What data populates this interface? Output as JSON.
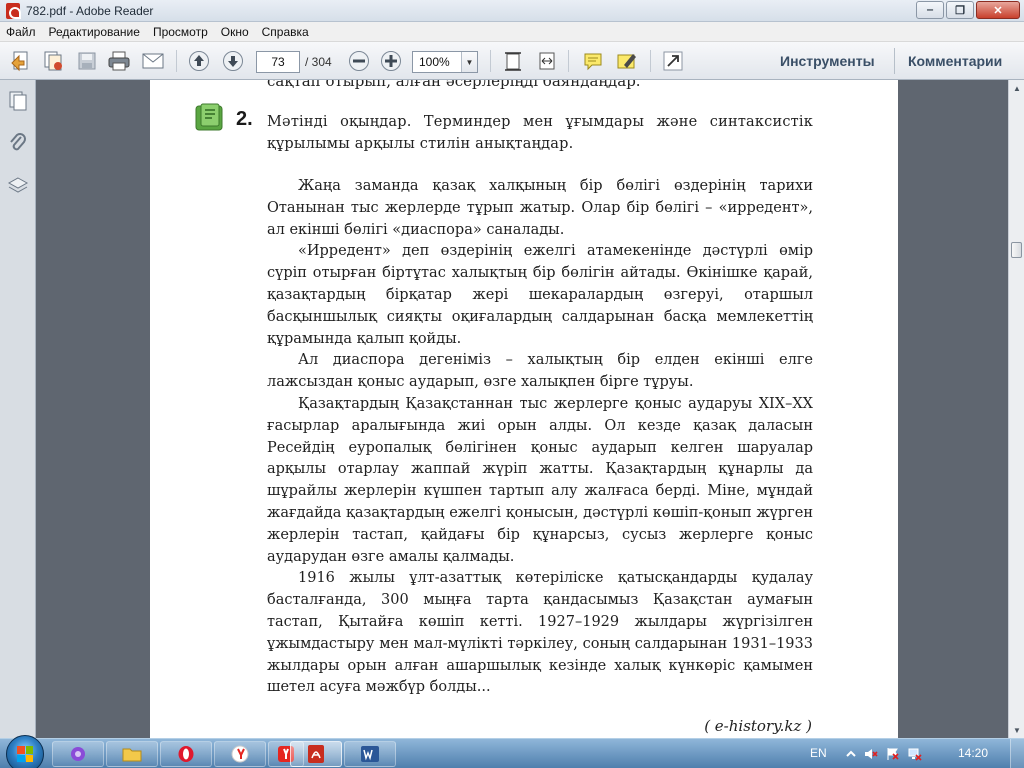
{
  "window": {
    "title": "782.pdf - Adobe Reader",
    "minimize_label": "‒",
    "restore_label": "❐",
    "close_label": "✕"
  },
  "menu": [
    "Файл",
    "Редактирование",
    "Просмотр",
    "Окно",
    "Справка"
  ],
  "toolbar": {
    "current_page": "73",
    "total_pages": "/ 304",
    "zoom": "100%",
    "zoom_dropdown_glyph": "▼",
    "tools_label": "Инструменты",
    "comments_label": "Комментарии"
  },
  "document": {
    "cut_line": "сақтап отырып, алған әсерлеріңді баяндаңдар.",
    "task_number": "2.",
    "task_text": "Мәтінді оқыңдар. Терминдер мен ұғымдары және синтаксистік құрылымы арқылы стилін анықтаңдар.",
    "paragraphs": [
      "Жаңа заманда қазақ халқының бір бөлігі өздерінің тарихи Отанынан тыс жерлерде тұрып жатыр. Олар бір бөлігі – «ирредент», ал екінші бөлігі «диаспора» саналады.",
      "«Ирредент» деп өздерінің ежелгі атамекенінде дәстүрлі өмір сүріп отырған біртұтас халықтың бір бөлігін айтады. Өкінішке қарай, қазақтардың бірқатар жері шекаралардың өзгеруі, отаршыл басқыншылық сияқты оқиғалардың салдарынан басқа мемлекеттің құрамында қалып қойды.",
      "Ал диаспора дегеніміз – халықтың бір елден екінші елге лажсыздан қоныс аударып, өзге халықпен бірге тұруы.",
      "Қазақтардың Қазақстаннан тыс жерлерге қоныс аударуы XIX–XX ғасырлар аралығында жиі орын алды. Ол кезде қазақ даласын Ресейдің еуропалық бөлігінен қоныс аударып келген шаруалар арқылы отарлау жаппай жүріп жатты. Қазақтардың құнарлы да шұрайлы жерлерін күшпен тартып алу жалғаса берді. Міне, мұндай жағдайда қазақтардың ежелгі қонысын, дәстүрлі көшіп-қонып жүрген жерлерін тастап, қайдағы бір құнарсыз, сусыз жерлерге қоныс аударудан өзге амалы қалмады.",
      "1916 жылы ұлт-азаттық көтеріліске қатысқандарды қудалау басталғанда, 300 мыңға тарта қандасымыз Қазақстан аумағын тастап, Қытайға көшіп кетті. 1927–1929 жылдары жүргізілген ұжымдастыру мен мал-мүлікті тәркілеу, соның салдарынан 1931–1933 жылдары орын алған ашаршылық кезінде халық күнкөріс қамымен шетел асуға мәжбүр болды..."
    ],
    "source": "( e-history.kz )"
  },
  "scrollbar": {
    "up_glyph": "▲",
    "down_glyph": "▼"
  },
  "taskbar": {
    "language": "EN",
    "clock": "14:20"
  },
  "colors": {
    "doc_background": "#5f6670",
    "page": "#ffffff",
    "accent_links": "#3a4f67",
    "task_icon_green": "#5aa642"
  }
}
